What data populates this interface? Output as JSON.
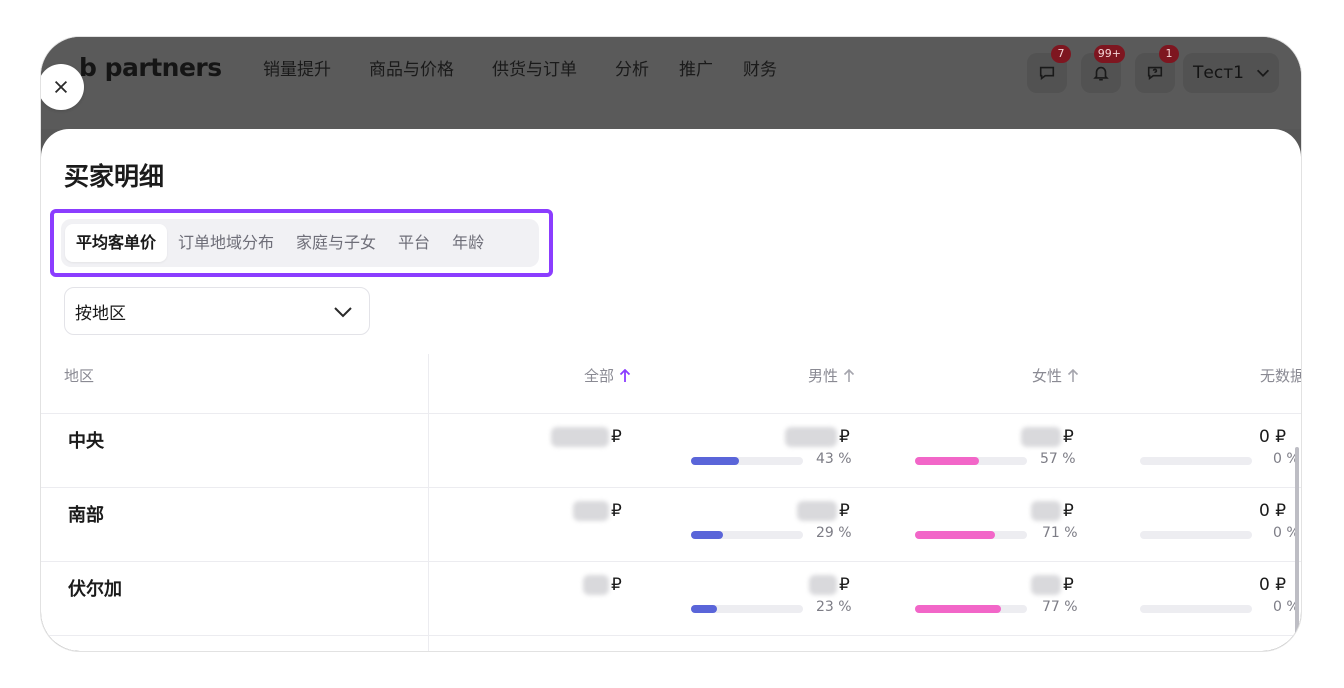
{
  "app": {
    "logo_text": "b partners",
    "nav": [
      "销量提升",
      "商品与价格",
      "供货与订单",
      "分析",
      "推广",
      "财务"
    ],
    "notifications": [
      {
        "icon": "chat-icon",
        "count": "7"
      },
      {
        "icon": "bell-icon",
        "count": "99+"
      },
      {
        "icon": "help-chat-icon",
        "count": "1"
      }
    ],
    "user_name": "Тест1"
  },
  "modal": {
    "title": "买家明细",
    "tabs": [
      {
        "label": "平均客单价",
        "active": true
      },
      {
        "label": "订单地域分布",
        "active": false
      },
      {
        "label": "家庭与子女",
        "active": false
      },
      {
        "label": "平台",
        "active": false
      },
      {
        "label": "年龄",
        "active": false
      }
    ],
    "selector_value": "按地区",
    "columns": {
      "region": "地区",
      "all": "全部",
      "male": "男性",
      "female": "女性",
      "no_data": "无数据"
    },
    "currency": "₽",
    "rows": [
      {
        "region": "中央",
        "male_pct": "43 %",
        "female_pct": "57 %",
        "none_value": "0 ₽",
        "none_pct": "0 %",
        "male_share": 43,
        "female_share": 57
      },
      {
        "region": "南部",
        "male_pct": "29 %",
        "female_pct": "71 %",
        "none_value": "0 ₽",
        "none_pct": "0 %",
        "male_share": 29,
        "female_share": 71
      },
      {
        "region": "伏尔加",
        "male_pct": "23 %",
        "female_pct": "77 %",
        "none_value": "0 ₽",
        "none_pct": "0 %",
        "male_share": 23,
        "female_share": 77
      }
    ]
  },
  "colors": {
    "accent_purple": "#8b3dff",
    "male_bar": "#5a65d9",
    "female_bar": "#f266c8",
    "badge": "#7e1620"
  }
}
